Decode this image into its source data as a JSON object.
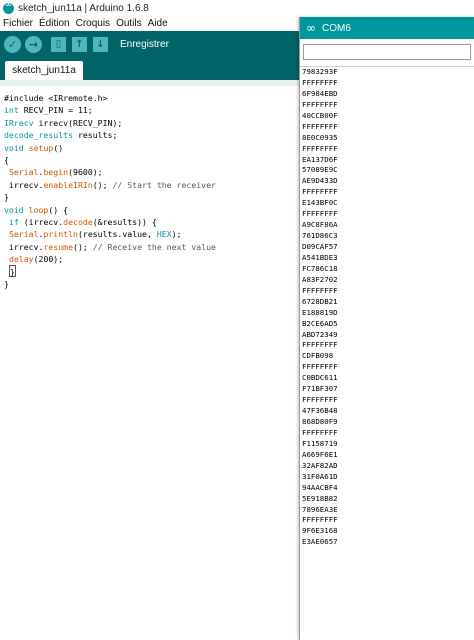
{
  "window": {
    "title": "sketch_jun11a | Arduino 1.6.8"
  },
  "menu": [
    "Fichier",
    "Édition",
    "Croquis",
    "Outils",
    "Aide"
  ],
  "toolbar": {
    "verify_glyph": "✓",
    "upload_glyph": "→",
    "new_glyph": "▯",
    "open_glyph": "↑",
    "save_glyph": "↓",
    "save_label": "Enregistrer"
  },
  "tab": {
    "label": "sketch_jun11a"
  },
  "code": [
    [
      {
        "t": "#include <IRremote.h>",
        "c": ""
      }
    ],
    [
      {
        "t": "int",
        "c": "kw"
      },
      {
        "t": " RECV_PIN = 11;",
        "c": ""
      }
    ],
    [
      {
        "t": "IRrecv",
        "c": "kw"
      },
      {
        "t": " irrecv(RECV_PIN);",
        "c": ""
      }
    ],
    [
      {
        "t": "decode_results",
        "c": "kw"
      },
      {
        "t": " results;",
        "c": ""
      }
    ],
    [
      {
        "t": "void",
        "c": "kw"
      },
      {
        "t": " ",
        "c": ""
      },
      {
        "t": "setup",
        "c": "fn"
      },
      {
        "t": "()",
        "c": ""
      }
    ],
    [
      {
        "t": "{",
        "c": ""
      }
    ],
    [
      {
        "t": " ",
        "c": ""
      },
      {
        "t": "Serial",
        "c": "fn"
      },
      {
        "t": ".",
        "c": ""
      },
      {
        "t": "begin",
        "c": "fn"
      },
      {
        "t": "(9600);",
        "c": ""
      }
    ],
    [
      {
        "t": " irrecv.",
        "c": ""
      },
      {
        "t": "enableIRIn",
        "c": "fn"
      },
      {
        "t": "(); ",
        "c": ""
      },
      {
        "t": "// Start the receiver",
        "c": "cm"
      }
    ],
    [
      {
        "t": "}",
        "c": ""
      }
    ],
    [
      {
        "t": "void",
        "c": "kw"
      },
      {
        "t": " ",
        "c": ""
      },
      {
        "t": "loop",
        "c": "fn"
      },
      {
        "t": "() {",
        "c": ""
      }
    ],
    [
      {
        "t": " ",
        "c": ""
      },
      {
        "t": "if",
        "c": "kw"
      },
      {
        "t": " (irrecv.",
        "c": ""
      },
      {
        "t": "decode",
        "c": "fn"
      },
      {
        "t": "(&results)) {",
        "c": ""
      }
    ],
    [
      {
        "t": " ",
        "c": ""
      },
      {
        "t": "Serial",
        "c": "fn"
      },
      {
        "t": ".",
        "c": ""
      },
      {
        "t": "println",
        "c": "fn"
      },
      {
        "t": "(results.value, ",
        "c": ""
      },
      {
        "t": "HEX",
        "c": "kw"
      },
      {
        "t": ");",
        "c": ""
      }
    ],
    [
      {
        "t": " irrecv.",
        "c": ""
      },
      {
        "t": "resume",
        "c": "fn"
      },
      {
        "t": "(); ",
        "c": ""
      },
      {
        "t": "// Receive the next value",
        "c": "cm"
      }
    ],
    [
      {
        "t": " ",
        "c": ""
      },
      {
        "t": "delay",
        "c": "fn"
      },
      {
        "t": "(200);",
        "c": ""
      }
    ],
    [
      {
        "t": " ",
        "c": ""
      },
      {
        "t": "}",
        "c": "cursor"
      }
    ],
    [
      {
        "t": "}",
        "c": ""
      }
    ]
  ],
  "serial": {
    "title": "COM6",
    "icon": "∞",
    "input_value": "",
    "output": [
      "7983293F",
      "FFFFFFFF",
      "6F984EBD",
      "FFFFFFFF",
      "40CCB00F",
      "FFFFFFFF",
      "8E0C0935",
      "FFFFFFFF",
      "EA137D6F",
      "57089E9C",
      "AE9D433D",
      "FFFFFFFF",
      "E143BF0C",
      "FFFFFFFF",
      "A9C8F86A",
      "761D86C3",
      "D09CAF57",
      "A541BDE3",
      "FC786C18",
      "A83F2702",
      "FFFFFFFF",
      "6728DB21",
      "E188819D",
      "B2CE6AD5",
      "ABD72349",
      "FFFFFFFF",
      "CDFB098",
      "FFFFFFFF",
      "C0BDC611",
      "F71BF307",
      "FFFFFFFF",
      "47F36B48",
      "868D80F9",
      "FFFFFFFF",
      "F1158719",
      "A669F6E1",
      "32AF82AD",
      "31F0A61D",
      "94AACBF4",
      "5E918B82",
      "7896EA3E",
      "FFFFFFFF",
      "9F6E3168",
      "E3AE0657"
    ]
  }
}
